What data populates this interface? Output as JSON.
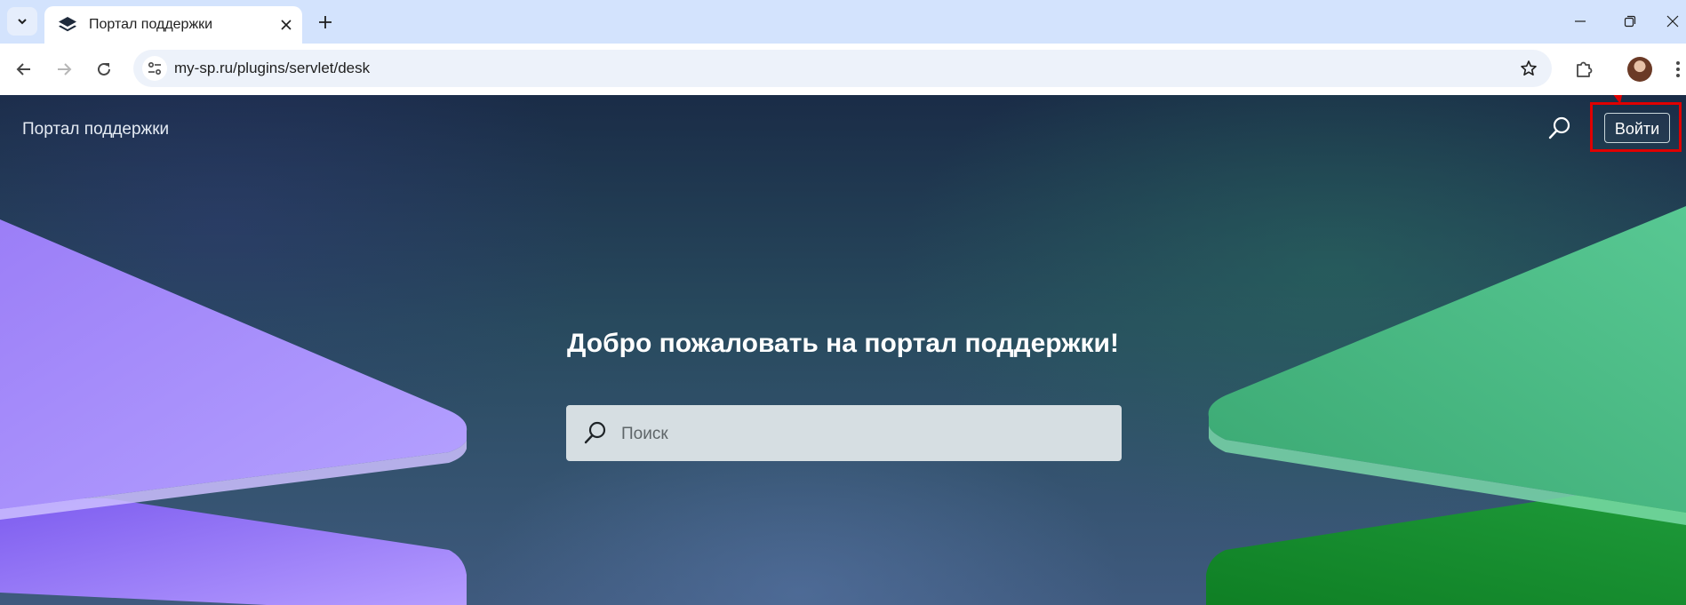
{
  "browser": {
    "tab": {
      "title": "Портал поддержки"
    },
    "address_bar": {
      "url": "my-sp.ru/plugins/servlet/desk"
    }
  },
  "icons": {
    "tab_search": "chevron-down-icon",
    "favicon": "layers-icon",
    "tab_close": "close-icon",
    "new_tab": "plus-icon",
    "minimize": "minimize-icon",
    "restore": "restore-icon",
    "close_window": "close-icon",
    "back": "arrow-left-icon",
    "forward": "arrow-right-icon",
    "reload": "reload-icon",
    "site_info": "tune-icon",
    "bookmark": "star-icon",
    "extensions": "puzzle-icon",
    "profile": "avatar",
    "menu": "more-vertical-icon",
    "header_search": "search-icon",
    "hero_search": "search-icon"
  },
  "page": {
    "header": {
      "site_title": "Портал поддержки",
      "login_label": "Войти"
    },
    "hero": {
      "title": "Добро пожаловать на портал поддержки!",
      "search_placeholder": "Поиск"
    }
  },
  "colors": {
    "annotation": "#e00000",
    "left_shape": "#a78bfa",
    "right_shape": "#4cc087"
  }
}
